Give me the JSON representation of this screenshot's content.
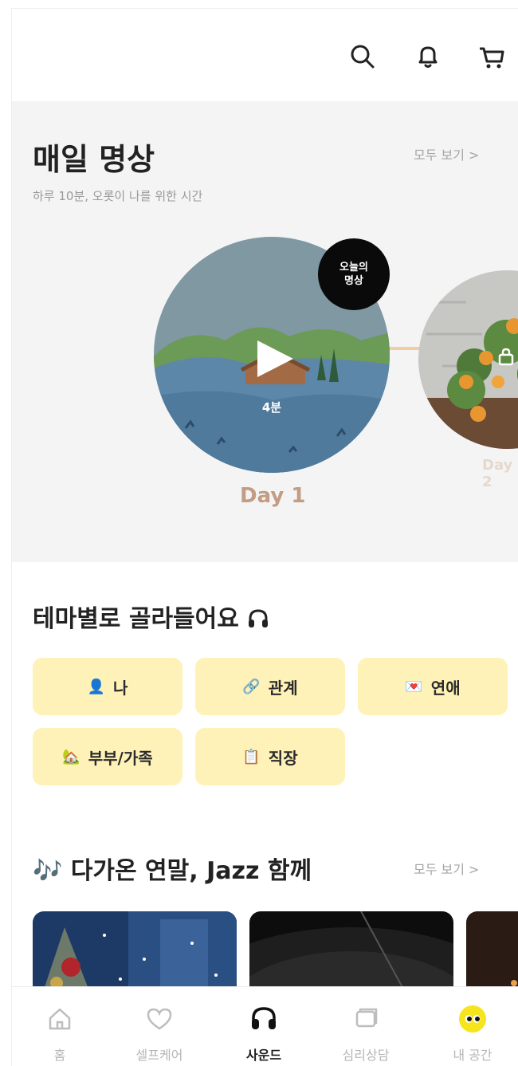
{
  "header": {
    "icons": [
      "search-icon",
      "bell-icon",
      "cart-icon"
    ]
  },
  "daily_meditation": {
    "title": "매일 명상",
    "subtitle": "하루 10분, 오롯이 나를 위한 시간",
    "see_all": "모두 보기 >",
    "today_badge_line1": "오늘의",
    "today_badge_line2": "명상",
    "items": [
      {
        "day": "Day 1",
        "duration": "4분",
        "locked": false
      },
      {
        "day": "Day 2",
        "locked": true
      }
    ],
    "colors": {
      "day_label": "#c29c83",
      "connector": "#f2cda0"
    }
  },
  "themes": {
    "title": "테마별로 골라들어요",
    "title_icon": "headphones-icon",
    "chips": [
      {
        "emoji": "👤",
        "label": "나"
      },
      {
        "emoji": "🔗",
        "label": "관계"
      },
      {
        "emoji": "💌",
        "label": "연애"
      },
      {
        "emoji": "🏡",
        "label": "부부/가족"
      },
      {
        "emoji": "📋",
        "label": "직장"
      }
    ],
    "chip_color": "#fff2b8"
  },
  "jazz": {
    "emoji": "🎶",
    "title": "다가온 연말, Jazz 함께",
    "see_all": "모두 보기 >"
  },
  "bottom_nav": {
    "items": [
      {
        "label": "홈",
        "icon": "home-icon",
        "active": false
      },
      {
        "label": "셀프케어",
        "icon": "heart-icon",
        "active": false
      },
      {
        "label": "사운드",
        "icon": "headphones-icon",
        "active": true
      },
      {
        "label": "심리상담",
        "icon": "chat-icon",
        "active": false
      },
      {
        "label": "내 공간",
        "icon": "eyes-icon",
        "active": false
      }
    ]
  }
}
